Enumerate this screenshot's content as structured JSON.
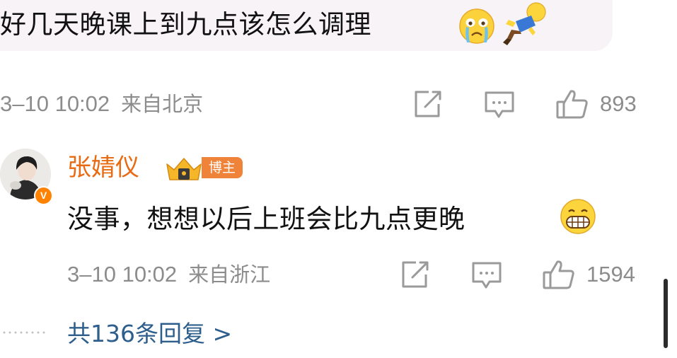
{
  "post": {
    "text": "好几天晚课上到九点该怎么调理",
    "emojis": [
      "crying-face-emoji",
      "falling-figure-emoji"
    ],
    "date": "3–10 10:02",
    "location": "来自北京",
    "like_count": "893",
    "bubble_color": "#f7f3f6"
  },
  "reply": {
    "username": "张婧仪",
    "badge_label": "博主",
    "text": "没事，想想以后上班会比九点更晚",
    "emoji": "grinning-face-emoji",
    "date": "3–10 10:02",
    "location": "来自浙江",
    "like_count": "1594",
    "verified": true,
    "username_color": "#e86a12",
    "badge_color": "#f0833a"
  },
  "more_replies": {
    "label": "共136条回复 >",
    "color": "#2d5e8c"
  },
  "icons": [
    "share-icon",
    "comment-icon",
    "like-icon"
  ],
  "meta_color": "#8c8c8c"
}
